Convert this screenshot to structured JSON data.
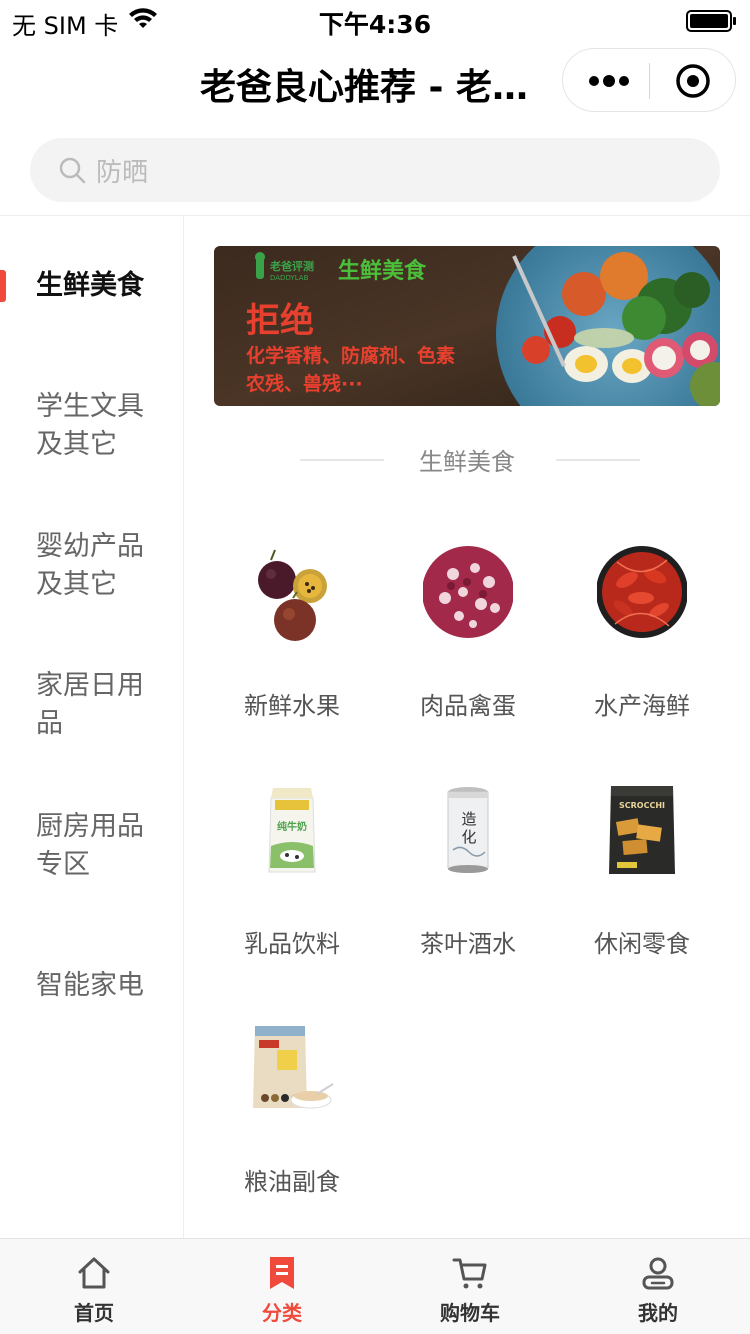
{
  "status_bar": {
    "carrier": "无 SIM 卡",
    "time": "下午4:36"
  },
  "nav": {
    "title": "老爸良心推荐 - 老…"
  },
  "search": {
    "placeholder": "防晒"
  },
  "sidebar": {
    "items": [
      {
        "label": "生鲜美食",
        "active": true
      },
      {
        "label": "学生文具及其它"
      },
      {
        "label": "婴幼产品及其它"
      },
      {
        "label": "家居日用品"
      },
      {
        "label": "厨房用品专区"
      },
      {
        "label": "智能家电"
      }
    ]
  },
  "banner": {
    "brand": "老爸评测",
    "brand_en": "DADDYLAB",
    "headline": "生鲜美食",
    "slogan": "拒绝",
    "line1": "化学香精、防腐剂、色素",
    "line2": "农残、兽残···"
  },
  "section": {
    "title": "生鲜美食"
  },
  "categories": [
    {
      "label": "新鲜水果",
      "icon": "passion-fruit-image"
    },
    {
      "label": "肉品禽蛋",
      "icon": "sausage-image"
    },
    {
      "label": "水产海鲜",
      "icon": "crayfish-image"
    },
    {
      "label": "乳品饮料",
      "icon": "milk-carton-image"
    },
    {
      "label": "茶叶酒水",
      "icon": "beverage-can-image"
    },
    {
      "label": "休闲零食",
      "icon": "snack-bag-image"
    },
    {
      "label": "粮油副食",
      "icon": "grain-powder-image"
    }
  ],
  "tabbar": {
    "items": [
      {
        "label": "首页",
        "icon": "home-icon"
      },
      {
        "label": "分类",
        "icon": "category-icon",
        "active": true
      },
      {
        "label": "购物车",
        "icon": "cart-icon"
      },
      {
        "label": "我的",
        "icon": "profile-icon"
      }
    ]
  },
  "colors": {
    "accent": "#f04a3c",
    "search_bg": "#f3f3f3",
    "tabbar_bg": "#f8f8f8"
  }
}
